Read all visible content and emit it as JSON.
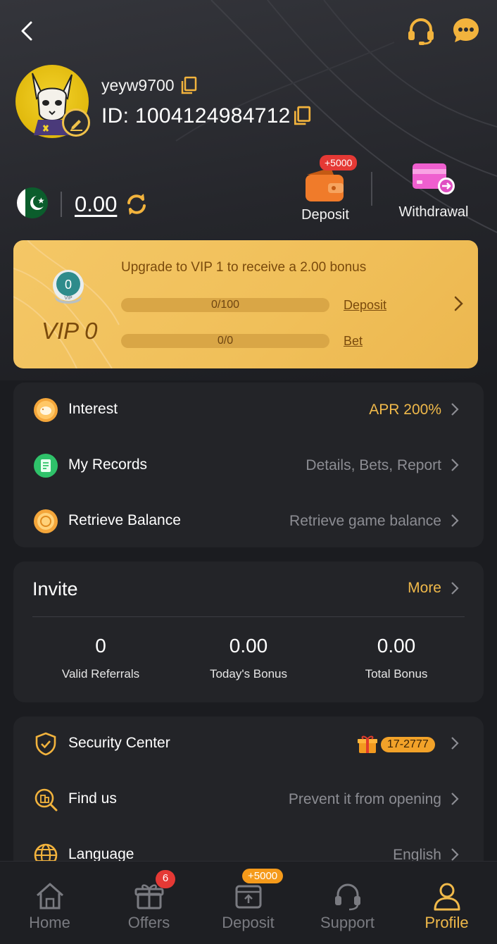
{
  "header": {
    "back_icon": "chevron-left-icon",
    "support_icon": "headset-icon",
    "chat_icon": "chat-bubble-icon"
  },
  "profile": {
    "username": "yeyw9700",
    "user_id": "ID: 1004124984712",
    "balance": "0.00",
    "country": "Pakistan"
  },
  "quick_actions": {
    "deposit_label": "Deposit",
    "deposit_tag": "+5000",
    "withdraw_label": "Withdrawal"
  },
  "vip": {
    "medal_level": "0",
    "medal_text": "VIP",
    "level": "VIP 0",
    "upgrade_text": "Upgrade to VIP 1 to receive a 2.00 bonus",
    "deposit_progress": "0/100",
    "deposit_fraction": 0,
    "deposit_link": "Deposit",
    "bet_progress": "0/0",
    "bet_fraction": 0,
    "bet_link": "Bet"
  },
  "menu1": [
    {
      "label": "Interest",
      "value": "APR 200%",
      "icon": "piggy-bank-icon"
    },
    {
      "label": "My Records",
      "value": "Details, Bets, Report",
      "icon": "records-icon"
    },
    {
      "label": "Retrieve Balance",
      "value": "Retrieve game balance",
      "icon": "coin-icon"
    }
  ],
  "invite": {
    "title": "Invite",
    "more": "More",
    "stats": [
      {
        "value": "0",
        "caption": "Valid Referrals"
      },
      {
        "value": "0.00",
        "caption": "Today's Bonus"
      },
      {
        "value": "0.00",
        "caption": "Total Bonus"
      }
    ]
  },
  "menu2": [
    {
      "label": "Security Center",
      "badge": "17-2777",
      "icon": "shield-check-icon"
    },
    {
      "label": "Find us",
      "value": "Prevent it from opening",
      "icon": "search-building-icon"
    },
    {
      "label": "Language",
      "value": "English",
      "icon": "globe-icon"
    }
  ],
  "nav": [
    {
      "label": "Home",
      "icon": "home-icon"
    },
    {
      "label": "Offers",
      "icon": "gift-icon",
      "badge": "6"
    },
    {
      "label": "Deposit",
      "icon": "deposit-icon",
      "badge": "+5000"
    },
    {
      "label": "Support",
      "icon": "headset-icon"
    },
    {
      "label": "Profile",
      "icon": "user-icon",
      "active": true
    }
  ],
  "colors": {
    "accent": "#f0b94a",
    "background": "#1b1c20",
    "panel": "#232428",
    "vip_card": "#f0bf59",
    "badge_red": "#e53935"
  }
}
